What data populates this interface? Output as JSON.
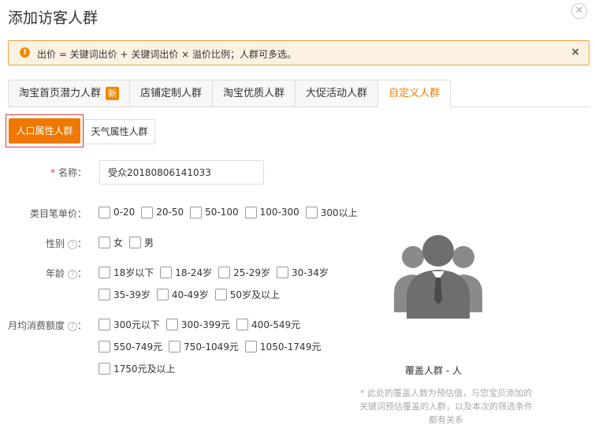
{
  "dialog": {
    "title": "添加访客人群",
    "close_icon": "close-icon"
  },
  "alert": {
    "icon": "warning-icon",
    "message": "出价 = 关键词出价 + 关键词出价 × 溢价比例；人群可多选。",
    "close": "×"
  },
  "tabs": [
    {
      "label": "淘宝首页潜力人群",
      "badge": "新"
    },
    {
      "label": "店铺定制人群"
    },
    {
      "label": "淘宝优质人群"
    },
    {
      "label": "大促活动人群"
    },
    {
      "label": "自定义人群",
      "active": true
    }
  ],
  "subtabs": {
    "population": "人口属性人群",
    "weather": "天气属性人群"
  },
  "form": {
    "name_label": "名称：",
    "name_required": "*",
    "name_value": "受众20180806141033",
    "price_label": "类目笔单价：",
    "price_options": [
      "0-20",
      "20-50",
      "50-100",
      "100-300",
      "300以上"
    ],
    "gender_label": "性别",
    "gender_options": [
      "女",
      "男"
    ],
    "age_label": "年龄",
    "age_options_row1": [
      "18岁以下",
      "18-24岁",
      "25-29岁",
      "30-34岁"
    ],
    "age_options_row2": [
      "35-39岁",
      "40-49岁",
      "50岁及以上"
    ],
    "spend_label": "月均消费额度",
    "spend_options_row1": [
      "300元以下",
      "300-399元",
      "400-549元"
    ],
    "spend_options_row2": [
      "550-749元",
      "750-1049元",
      "1050-1749元"
    ],
    "spend_options_row3": [
      "1750元及以上"
    ],
    "colon": "："
  },
  "coverage": {
    "label": "覆盖人群 - 人",
    "note_line1": "* 此处的覆盖人数为预估值，与您宝贝添加的",
    "note_line2": "关键词预估覆盖的人群，以及本次的筛选条件",
    "note_line3": "都有关系"
  }
}
